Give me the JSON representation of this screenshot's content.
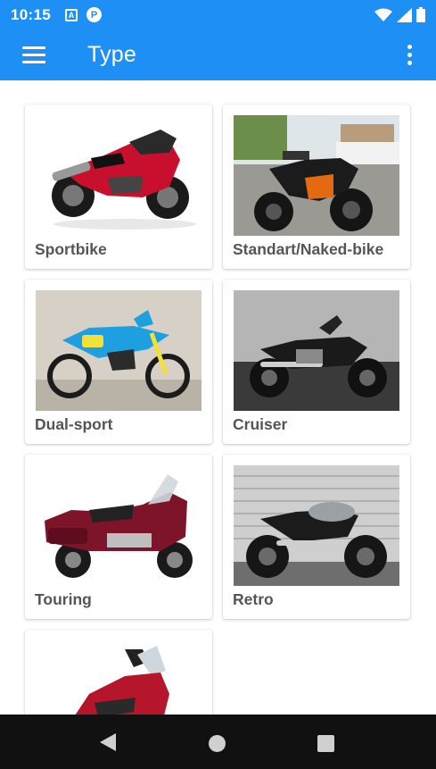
{
  "status_bar": {
    "time": "10:15",
    "icons": [
      "font-accessibility-icon",
      "p-notification-icon",
      "wifi-icon",
      "signal-icon",
      "battery-icon"
    ]
  },
  "app_bar": {
    "title": "Type",
    "menu_icon": "hamburger-menu-icon",
    "more_icon": "more-vertical-icon"
  },
  "colors": {
    "primary": "#1e90f5",
    "label": "#555555",
    "nav_bar": "#111111"
  },
  "types": [
    {
      "label": "Sportbike",
      "image": "sportbike-photo"
    },
    {
      "label": "Standart/Naked-bike",
      "image": "naked-bike-photo"
    },
    {
      "label": "Dual-sport",
      "image": "dual-sport-photo"
    },
    {
      "label": "Cruiser",
      "image": "cruiser-photo"
    },
    {
      "label": "Touring",
      "image": "touring-photo"
    },
    {
      "label": "Retro",
      "image": "retro-photo"
    },
    {
      "label": "",
      "image": "scooter-photo"
    }
  ],
  "nav_bar": {
    "buttons": [
      "back-icon",
      "home-icon",
      "recents-icon"
    ]
  }
}
